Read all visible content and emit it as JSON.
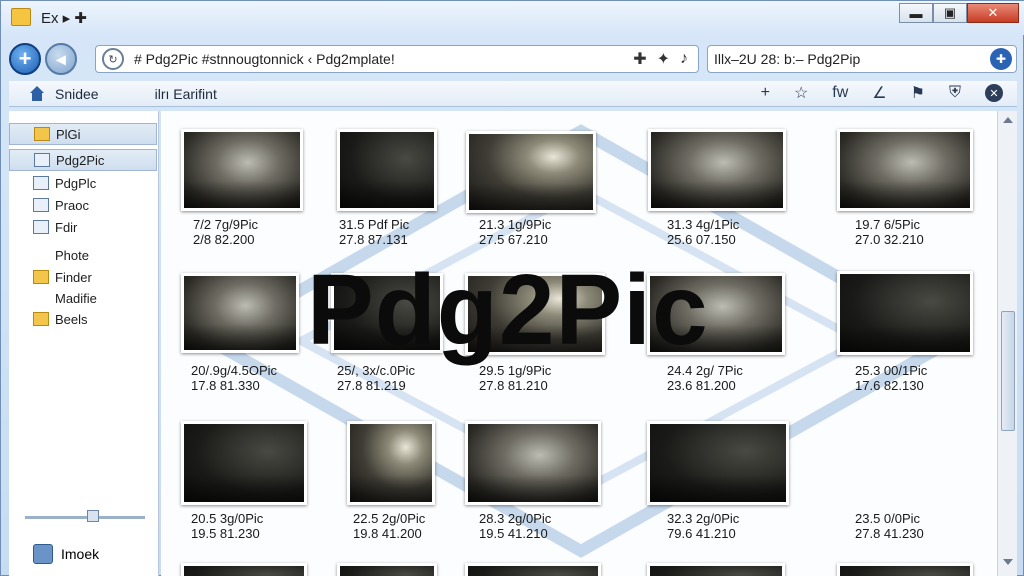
{
  "window": {
    "title": "Ex ▸ ✚",
    "buttons": {
      "minimize": "▬",
      "maximize": "▣",
      "close": "✕"
    }
  },
  "address": {
    "value": "# Pdg2Pic #stnnougtonnick ‹ Pdg2mplate!",
    "add_glyph": "✚",
    "star_glyph": "✦",
    "go_glyph": "♪",
    "refresh_glyph": "↻"
  },
  "search": {
    "value": "Illx–2U 28: b:– Pdg2Pip",
    "go_glyph": "✚"
  },
  "toolbar": {
    "home_label": "Snidee",
    "second_label": "ilrı Earifint",
    "right": {
      "plus": "+",
      "star": "☆",
      "text": "fw",
      "pen": "∠",
      "flag": "⚑",
      "shield": "⛨",
      "close": "✕"
    }
  },
  "sidebar": {
    "items": [
      {
        "label": "PlGi",
        "icon": "folder-icon",
        "selected": true
      },
      {
        "label": "Pdg2Pic",
        "icon": "file-icon",
        "selected": true
      },
      {
        "label": "PdgPlc",
        "icon": "image-icon"
      },
      {
        "label": "Praoc",
        "icon": "file-icon"
      },
      {
        "label": "Fdir",
        "icon": "file-icon"
      },
      {
        "label": "Phote",
        "icon": ""
      },
      {
        "label": "Finder",
        "icon": "folder-icon"
      },
      {
        "label": "Madifie",
        "icon": ""
      },
      {
        "label": "Beels",
        "icon": "folder-icon"
      }
    ],
    "footer_label": "Imoek"
  },
  "overlay_title": "Pdg2Pic",
  "thumbnails": [
    {
      "name": "7/2 7g/9Pic",
      "meta": "2/8 82.200"
    },
    {
      "name": "31.5 Pdf Pic",
      "meta": "27.8 87.131"
    },
    {
      "name": "21.3 1g/9Pic",
      "meta": "27.5 67.210"
    },
    {
      "name": "31.3 4g/1Pic",
      "meta": "25.6 07.150"
    },
    {
      "name": "19.7 6/5Pic",
      "meta": "27.0 32.210"
    },
    {
      "name": "20/.9g/4.5OPic",
      "meta": "17.8 81.330"
    },
    {
      "name": "25/, 3x/c.0Pic",
      "meta": "27.8 81.219"
    },
    {
      "name": "29.5 1g/9Pic",
      "meta": "27.8 81.210"
    },
    {
      "name": "24.4 2g/ 7Pic",
      "meta": "23.6 81.200"
    },
    {
      "name": "25.3 00/1Pic",
      "meta": "17.6 82.130"
    },
    {
      "name": "20.5 3g/0Pic",
      "meta": "19.5 81.230"
    },
    {
      "name": "22.5 2g/0Pic",
      "meta": "19.8 41.200"
    },
    {
      "name": "28.3 2g/0Pic",
      "meta": "19.5 41.210"
    },
    {
      "name": "32.3 2g/0Pic",
      "meta": "79.6 41.210"
    },
    {
      "name": "23.5 0/0Pic",
      "meta": "27.8 41.230"
    }
  ]
}
